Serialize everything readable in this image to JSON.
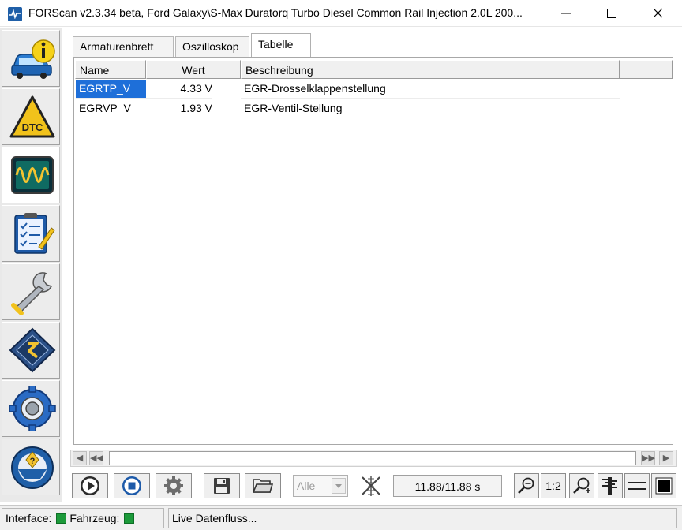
{
  "window": {
    "title": "FORScan v2.3.34 beta, Ford Galaxy\\S-Max Duratorq Turbo Diesel Common Rail Injection 2.0L 200..."
  },
  "sidebar": {
    "items": [
      {
        "name": "vehicle-info",
        "icon": "car-info-icon"
      },
      {
        "name": "dtc",
        "icon": "dtc-warning-icon"
      },
      {
        "name": "oscilloscope",
        "icon": "oscilloscope-icon",
        "active": true
      },
      {
        "name": "tests",
        "icon": "checklist-icon"
      },
      {
        "name": "service",
        "icon": "wrench-icon"
      },
      {
        "name": "configuration",
        "icon": "chip-icon"
      },
      {
        "name": "settings",
        "icon": "gear-icon"
      },
      {
        "name": "help",
        "icon": "steering-help-icon"
      }
    ]
  },
  "tabs": [
    {
      "label": "Armaturenbrett",
      "active": false
    },
    {
      "label": "Oszilloskop",
      "active": false
    },
    {
      "label": "Tabelle",
      "active": true
    }
  ],
  "table": {
    "columns": [
      "Name",
      "Wert",
      "Beschreibung"
    ],
    "rows": [
      {
        "name": "EGRTP_V",
        "value": "4.33 V",
        "description": "EGR-Drosselklappenstellung",
        "selected": true
      },
      {
        "name": "EGRVP_V",
        "value": "1.93 V",
        "description": "EGR-Ventil-Stellung",
        "selected": false
      }
    ]
  },
  "toolbar": {
    "filter_value": "Alle",
    "time": "11.88/11.88 s",
    "zoom_ratio": "1:2"
  },
  "statusbar": {
    "interface_label": "Interface:",
    "vehicle_label": "Fahrzeug:",
    "status_text": "Live Datenfluss...",
    "led_color": "#1c9a3a"
  },
  "colors": {
    "selection": "#1e6fd9",
    "accent": "#1f5fa8"
  }
}
